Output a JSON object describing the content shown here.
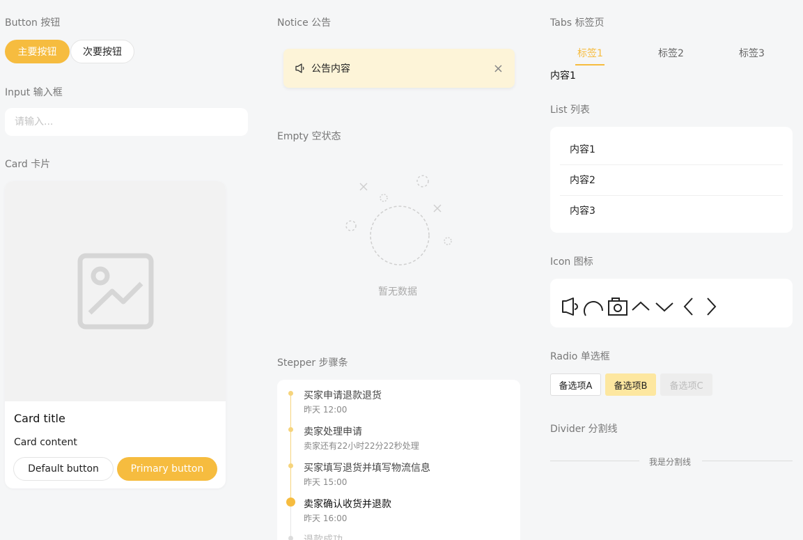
{
  "sections": {
    "button": "Button 按钮",
    "input": "Input 输入框",
    "card": "Card 卡片",
    "notice": "Notice 公告",
    "empty": "Empty 空状态",
    "stepper": "Stepper 步骤条",
    "tabs": "Tabs 标签页",
    "list": "List 列表",
    "icon": "Icon 图标",
    "radio": "Radio 单选框",
    "divider": "Divider 分割线"
  },
  "buttons": {
    "primary": "主要按钮",
    "secondary": "次要按钮"
  },
  "input": {
    "placeholder": "请输入..."
  },
  "card": {
    "title": "Card title",
    "content": "Card content",
    "default_button": "Default button",
    "primary_button": "Primary button"
  },
  "notice": {
    "text": "公告内容",
    "close": "×"
  },
  "empty": {
    "text": "暂无数据"
  },
  "stepper": {
    "steps": [
      {
        "title": "买家申请退款退货",
        "time": "昨天 12:00",
        "state": "done"
      },
      {
        "title": "卖家处理申请",
        "time": "卖家还有22小时22分22秒处理",
        "state": "done"
      },
      {
        "title": "买家填写退货并填写物流信息",
        "time": "昨天 15:00",
        "state": "done"
      },
      {
        "title": "卖家确认收货并退款",
        "time": "昨天 16:00",
        "state": "active"
      },
      {
        "title": "退款成功",
        "time": "",
        "state": "pending"
      }
    ]
  },
  "tabs": {
    "items": [
      "标签1",
      "标签2",
      "标签3"
    ],
    "active_index": 0,
    "content": "内容1"
  },
  "list": {
    "items": [
      "内容1",
      "内容2",
      "内容3"
    ]
  },
  "icons": [
    "notice-icon",
    "loading-icon",
    "camera-icon",
    "arrow-up-icon",
    "arrow-down-icon",
    "arrow-left-icon",
    "arrow-right-icon"
  ],
  "radio": {
    "options": [
      "备选项A",
      "备选项B",
      "备选项C"
    ],
    "selected_index": 1,
    "disabled_index": 2
  },
  "divider": {
    "text": "我是分割线"
  },
  "colors": {
    "accent": "#f6bc3f",
    "notice_bg": "#fdf4d8",
    "radio_selected_bg": "#fde7a0"
  }
}
